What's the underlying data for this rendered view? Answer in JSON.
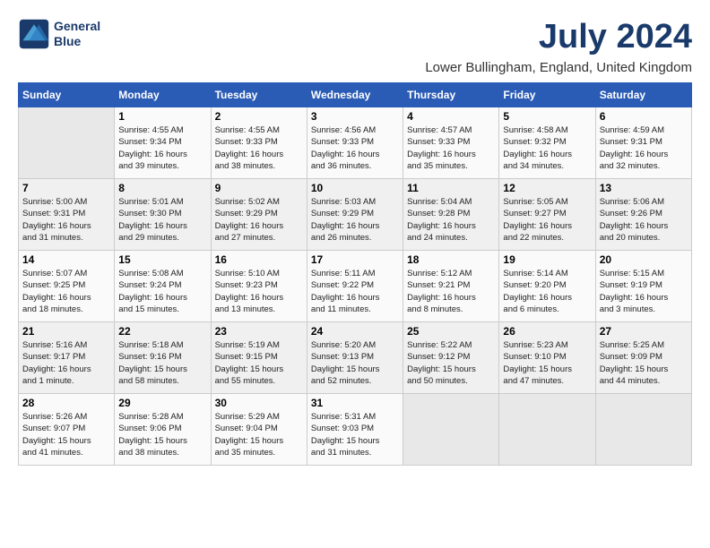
{
  "header": {
    "logo_line1": "General",
    "logo_line2": "Blue",
    "month_title": "July 2024",
    "location": "Lower Bullingham, England, United Kingdom"
  },
  "days_of_week": [
    "Sunday",
    "Monday",
    "Tuesday",
    "Wednesday",
    "Thursday",
    "Friday",
    "Saturday"
  ],
  "weeks": [
    [
      {
        "day": "",
        "info": ""
      },
      {
        "day": "1",
        "info": "Sunrise: 4:55 AM\nSunset: 9:34 PM\nDaylight: 16 hours\nand 39 minutes."
      },
      {
        "day": "2",
        "info": "Sunrise: 4:55 AM\nSunset: 9:33 PM\nDaylight: 16 hours\nand 38 minutes."
      },
      {
        "day": "3",
        "info": "Sunrise: 4:56 AM\nSunset: 9:33 PM\nDaylight: 16 hours\nand 36 minutes."
      },
      {
        "day": "4",
        "info": "Sunrise: 4:57 AM\nSunset: 9:33 PM\nDaylight: 16 hours\nand 35 minutes."
      },
      {
        "day": "5",
        "info": "Sunrise: 4:58 AM\nSunset: 9:32 PM\nDaylight: 16 hours\nand 34 minutes."
      },
      {
        "day": "6",
        "info": "Sunrise: 4:59 AM\nSunset: 9:31 PM\nDaylight: 16 hours\nand 32 minutes."
      }
    ],
    [
      {
        "day": "7",
        "info": "Sunrise: 5:00 AM\nSunset: 9:31 PM\nDaylight: 16 hours\nand 31 minutes."
      },
      {
        "day": "8",
        "info": "Sunrise: 5:01 AM\nSunset: 9:30 PM\nDaylight: 16 hours\nand 29 minutes."
      },
      {
        "day": "9",
        "info": "Sunrise: 5:02 AM\nSunset: 9:29 PM\nDaylight: 16 hours\nand 27 minutes."
      },
      {
        "day": "10",
        "info": "Sunrise: 5:03 AM\nSunset: 9:29 PM\nDaylight: 16 hours\nand 26 minutes."
      },
      {
        "day": "11",
        "info": "Sunrise: 5:04 AM\nSunset: 9:28 PM\nDaylight: 16 hours\nand 24 minutes."
      },
      {
        "day": "12",
        "info": "Sunrise: 5:05 AM\nSunset: 9:27 PM\nDaylight: 16 hours\nand 22 minutes."
      },
      {
        "day": "13",
        "info": "Sunrise: 5:06 AM\nSunset: 9:26 PM\nDaylight: 16 hours\nand 20 minutes."
      }
    ],
    [
      {
        "day": "14",
        "info": "Sunrise: 5:07 AM\nSunset: 9:25 PM\nDaylight: 16 hours\nand 18 minutes."
      },
      {
        "day": "15",
        "info": "Sunrise: 5:08 AM\nSunset: 9:24 PM\nDaylight: 16 hours\nand 15 minutes."
      },
      {
        "day": "16",
        "info": "Sunrise: 5:10 AM\nSunset: 9:23 PM\nDaylight: 16 hours\nand 13 minutes."
      },
      {
        "day": "17",
        "info": "Sunrise: 5:11 AM\nSunset: 9:22 PM\nDaylight: 16 hours\nand 11 minutes."
      },
      {
        "day": "18",
        "info": "Sunrise: 5:12 AM\nSunset: 9:21 PM\nDaylight: 16 hours\nand 8 minutes."
      },
      {
        "day": "19",
        "info": "Sunrise: 5:14 AM\nSunset: 9:20 PM\nDaylight: 16 hours\nand 6 minutes."
      },
      {
        "day": "20",
        "info": "Sunrise: 5:15 AM\nSunset: 9:19 PM\nDaylight: 16 hours\nand 3 minutes."
      }
    ],
    [
      {
        "day": "21",
        "info": "Sunrise: 5:16 AM\nSunset: 9:17 PM\nDaylight: 16 hours\nand 1 minute."
      },
      {
        "day": "22",
        "info": "Sunrise: 5:18 AM\nSunset: 9:16 PM\nDaylight: 15 hours\nand 58 minutes."
      },
      {
        "day": "23",
        "info": "Sunrise: 5:19 AM\nSunset: 9:15 PM\nDaylight: 15 hours\nand 55 minutes."
      },
      {
        "day": "24",
        "info": "Sunrise: 5:20 AM\nSunset: 9:13 PM\nDaylight: 15 hours\nand 52 minutes."
      },
      {
        "day": "25",
        "info": "Sunrise: 5:22 AM\nSunset: 9:12 PM\nDaylight: 15 hours\nand 50 minutes."
      },
      {
        "day": "26",
        "info": "Sunrise: 5:23 AM\nSunset: 9:10 PM\nDaylight: 15 hours\nand 47 minutes."
      },
      {
        "day": "27",
        "info": "Sunrise: 5:25 AM\nSunset: 9:09 PM\nDaylight: 15 hours\nand 44 minutes."
      }
    ],
    [
      {
        "day": "28",
        "info": "Sunrise: 5:26 AM\nSunset: 9:07 PM\nDaylight: 15 hours\nand 41 minutes."
      },
      {
        "day": "29",
        "info": "Sunrise: 5:28 AM\nSunset: 9:06 PM\nDaylight: 15 hours\nand 38 minutes."
      },
      {
        "day": "30",
        "info": "Sunrise: 5:29 AM\nSunset: 9:04 PM\nDaylight: 15 hours\nand 35 minutes."
      },
      {
        "day": "31",
        "info": "Sunrise: 5:31 AM\nSunset: 9:03 PM\nDaylight: 15 hours\nand 31 minutes."
      },
      {
        "day": "",
        "info": ""
      },
      {
        "day": "",
        "info": ""
      },
      {
        "day": "",
        "info": ""
      }
    ]
  ]
}
